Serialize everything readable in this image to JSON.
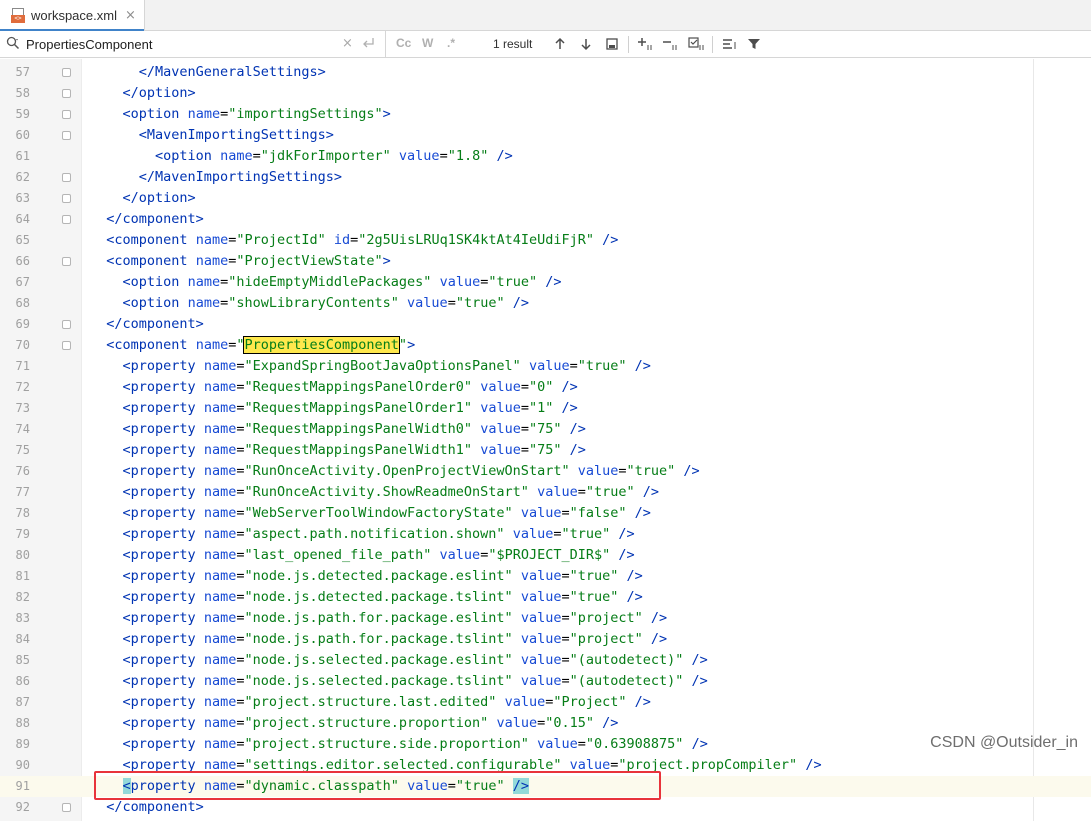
{
  "tab": {
    "title": "workspace.xml",
    "icon": "xml-file-icon",
    "close": "×"
  },
  "search": {
    "query": "PropertiesComponent",
    "clear_glyph": "×",
    "cc_label": "Cc",
    "w_label": "W",
    "regex_label": ".*",
    "result_count": "1 result"
  },
  "colors": {
    "tag": "#0033b3",
    "attr": "#174ad4",
    "value": "#067d17",
    "match": "#ffe84d",
    "highlight_box": "#e8333b"
  },
  "lines": [
    {
      "n": "57",
      "code": "      </MavenGeneralSettings>"
    },
    {
      "n": "58",
      "code": "    </option>"
    },
    {
      "n": "59",
      "code": "    <option name=\"importingSettings\">"
    },
    {
      "n": "60",
      "code": "      <MavenImportingSettings>"
    },
    {
      "n": "61",
      "code": "        <option name=\"jdkForImporter\" value=\"1.8\" />"
    },
    {
      "n": "62",
      "code": "      </MavenImportingSettings>"
    },
    {
      "n": "63",
      "code": "    </option>"
    },
    {
      "n": "64",
      "code": "  </component>"
    },
    {
      "n": "65",
      "code": "  <component name=\"ProjectId\" id=\"2g5UisLRUq1SK4ktAt4IeUdiFjR\" />"
    },
    {
      "n": "66",
      "code": "  <component name=\"ProjectViewState\">"
    },
    {
      "n": "67",
      "code": "    <option name=\"hideEmptyMiddlePackages\" value=\"true\" />"
    },
    {
      "n": "68",
      "code": "    <option name=\"showLibraryContents\" value=\"true\" />"
    },
    {
      "n": "69",
      "code": "  </component>"
    },
    {
      "n": "70",
      "code": "  <component name=\"PropertiesComponent\">"
    },
    {
      "n": "71",
      "code": "    <property name=\"ExpandSpringBootJavaOptionsPanel\" value=\"true\" />"
    },
    {
      "n": "72",
      "code": "    <property name=\"RequestMappingsPanelOrder0\" value=\"0\" />"
    },
    {
      "n": "73",
      "code": "    <property name=\"RequestMappingsPanelOrder1\" value=\"1\" />"
    },
    {
      "n": "74",
      "code": "    <property name=\"RequestMappingsPanelWidth0\" value=\"75\" />"
    },
    {
      "n": "75",
      "code": "    <property name=\"RequestMappingsPanelWidth1\" value=\"75\" />"
    },
    {
      "n": "76",
      "code": "    <property name=\"RunOnceActivity.OpenProjectViewOnStart\" value=\"true\" />"
    },
    {
      "n": "77",
      "code": "    <property name=\"RunOnceActivity.ShowReadmeOnStart\" value=\"true\" />"
    },
    {
      "n": "78",
      "code": "    <property name=\"WebServerToolWindowFactoryState\" value=\"false\" />"
    },
    {
      "n": "79",
      "code": "    <property name=\"aspect.path.notification.shown\" value=\"true\" />"
    },
    {
      "n": "80",
      "code": "    <property name=\"last_opened_file_path\" value=\"$PROJECT_DIR$\" />"
    },
    {
      "n": "81",
      "code": "    <property name=\"node.js.detected.package.eslint\" value=\"true\" />"
    },
    {
      "n": "82",
      "code": "    <property name=\"node.js.detected.package.tslint\" value=\"true\" />"
    },
    {
      "n": "83",
      "code": "    <property name=\"node.js.path.for.package.eslint\" value=\"project\" />"
    },
    {
      "n": "84",
      "code": "    <property name=\"node.js.path.for.package.tslint\" value=\"project\" />"
    },
    {
      "n": "85",
      "code": "    <property name=\"node.js.selected.package.eslint\" value=\"(autodetect)\" />"
    },
    {
      "n": "86",
      "code": "    <property name=\"node.js.selected.package.tslint\" value=\"(autodetect)\" />"
    },
    {
      "n": "87",
      "code": "    <property name=\"project.structure.last.edited\" value=\"Project\" />"
    },
    {
      "n": "88",
      "code": "    <property name=\"project.structure.proportion\" value=\"0.15\" />"
    },
    {
      "n": "89",
      "code": "    <property name=\"project.structure.side.proportion\" value=\"0.63908875\" />"
    },
    {
      "n": "90",
      "code": "    <property name=\"settings.editor.selected.configurable\" value=\"project.propCompiler\" />"
    },
    {
      "n": "91",
      "code": "    <property name=\"dynamic.classpath\" value=\"true\" />"
    },
    {
      "n": "92",
      "code": "  </component>"
    }
  ],
  "watermark": "CSDN @Outsider_in"
}
